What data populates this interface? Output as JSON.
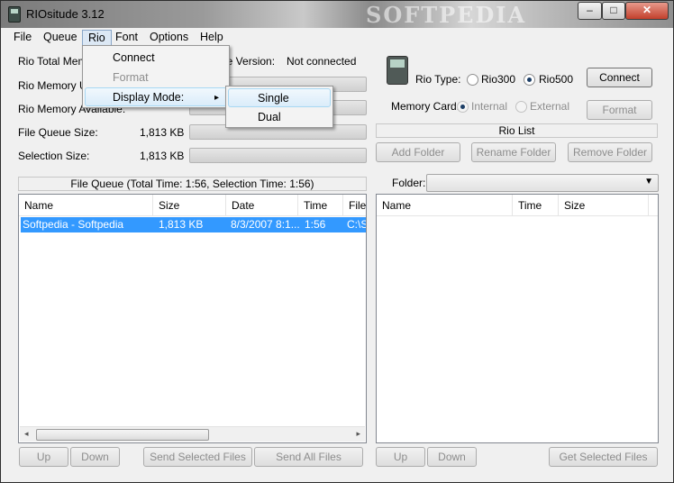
{
  "window": {
    "title": "RIOsitude 3.12",
    "watermark": "SOFTPEDIA",
    "min_glyph": "–",
    "max_glyph": "□",
    "close_glyph": "✕"
  },
  "menubar": [
    "File",
    "Queue",
    "Rio",
    "Font",
    "Options",
    "Help"
  ],
  "rio_menu": {
    "items": [
      "Connect",
      "Format",
      "Display Mode:"
    ],
    "submenu_arrow": "▸"
  },
  "display_mode_submenu": [
    "Single",
    "Dual"
  ],
  "status": {
    "rio_total_memory_label": "Rio Total Mem",
    "rio_memory_used_label": "Rio Memory Us",
    "rio_memory_available_label": "Rio Memory Available:",
    "firmware_version_label": "are Version:",
    "firmware_version_value": "Not connected",
    "file_queue_size_label": "File Queue Size:",
    "file_queue_size_value": "1,813 KB",
    "selection_size_label": "Selection Size:",
    "selection_size_value": "1,813 KB"
  },
  "file_queue": {
    "title": "File Queue (Total Time: 1:56, Selection Time: 1:56)",
    "columns": [
      "Name",
      "Size",
      "Date",
      "Time",
      "File"
    ],
    "rows": [
      {
        "name": "Softpedia - Softpedia",
        "size": "1,813 KB",
        "date": "8/3/2007 8:1...",
        "time": "1:56",
        "file": "C:\\S"
      }
    ],
    "scroll_left": "◂",
    "scroll_right": "▸"
  },
  "left_buttons": [
    "Up",
    "Down",
    "Send Selected Files",
    "Send All Files"
  ],
  "rio_panel": {
    "rio_type_label": "Rio Type:",
    "rio_types": [
      "Rio300",
      "Rio500"
    ],
    "selected_type": "Rio500",
    "connect_button": "Connect",
    "format_button": "Format",
    "memory_card_label": "Memory Card:",
    "memory_cards": [
      "Internal",
      "External"
    ],
    "selected_memory_card": "Internal",
    "rio_list_title": "Rio List",
    "add_folder": "Add Folder",
    "rename_folder": "Rename Folder",
    "remove_folder": "Remove Folder",
    "folder_label": "Folder:",
    "combo_arrow": "▼",
    "list_columns": [
      "Name",
      "Time",
      "Size"
    ]
  },
  "right_buttons": [
    "Up",
    "Down",
    "Get Selected Files"
  ]
}
